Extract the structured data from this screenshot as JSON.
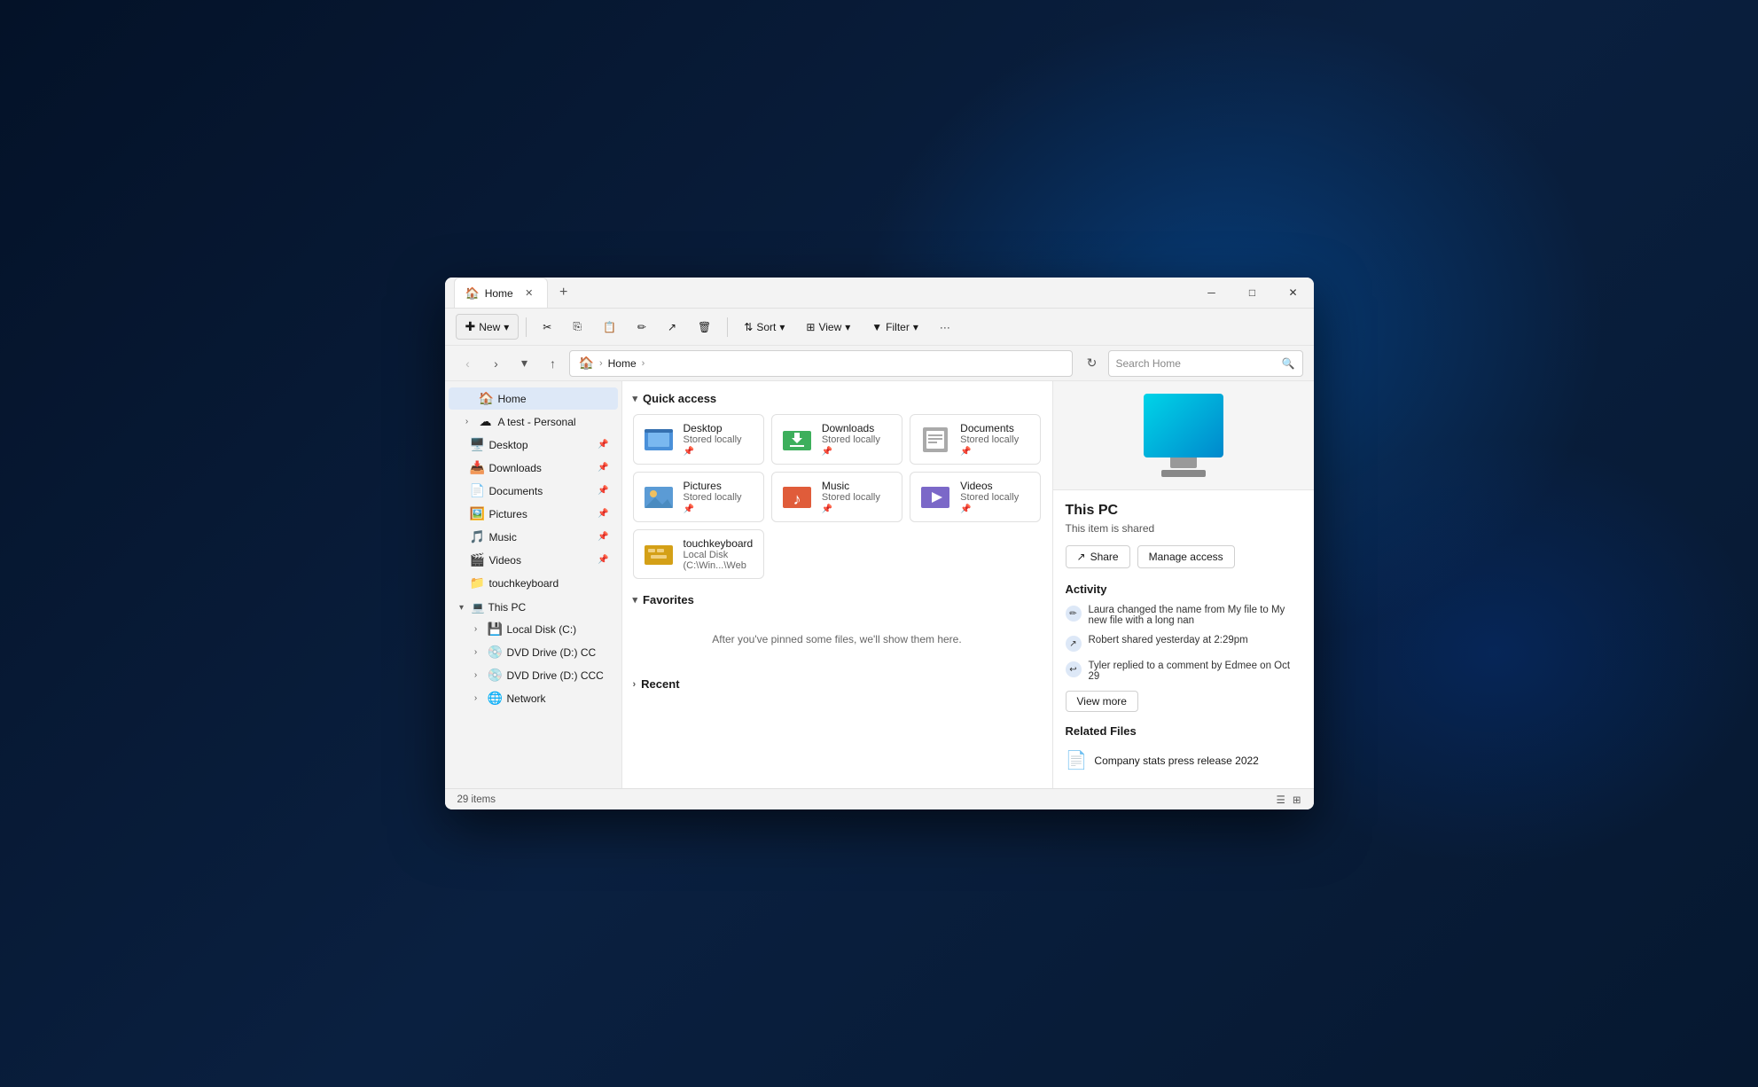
{
  "window": {
    "title": "Home",
    "tab_label": "Home",
    "close": "✕",
    "minimize": "─",
    "maximize": "□"
  },
  "toolbar": {
    "new_label": "New",
    "sort_label": "Sort",
    "view_label": "View",
    "filter_label": "Filter",
    "new_chevron": "▾",
    "sort_chevron": "▾",
    "view_chevron": "▾",
    "filter_chevron": "▾"
  },
  "address_bar": {
    "home_icon": "🏠",
    "home_label": "Home",
    "search_placeholder": "Search Home"
  },
  "sidebar": {
    "home_label": "Home",
    "cloud_label": "A test - Personal",
    "items": [
      {
        "id": "desktop",
        "label": "Desktop",
        "icon": "🖥️",
        "pinned": true
      },
      {
        "id": "downloads",
        "label": "Downloads",
        "icon": "📥",
        "pinned": true
      },
      {
        "id": "documents",
        "label": "Documents",
        "icon": "📄",
        "pinned": true
      },
      {
        "id": "pictures",
        "label": "Pictures",
        "icon": "🖼️",
        "pinned": true
      },
      {
        "id": "music",
        "label": "Music",
        "icon": "🎵",
        "pinned": true
      },
      {
        "id": "videos",
        "label": "Videos",
        "icon": "🎬",
        "pinned": true
      },
      {
        "id": "touchkeyboard",
        "label": "touchkeyboard",
        "icon": "📁",
        "pinned": false
      }
    ],
    "thispc": {
      "label": "This PC",
      "children": [
        {
          "id": "local-disk",
          "label": "Local Disk (C:)",
          "icon": "💾"
        },
        {
          "id": "dvd-d",
          "label": "DVD Drive (D:) CC",
          "icon": "💿"
        },
        {
          "id": "dvd-d2",
          "label": "DVD Drive (D:) CCC",
          "icon": "💿"
        },
        {
          "id": "network",
          "label": "Network",
          "icon": "🌐"
        }
      ]
    }
  },
  "quick_access": {
    "section_label": "Quick access",
    "folders": [
      {
        "id": "desktop",
        "name": "Desktop",
        "sub": "Stored locally",
        "icon": "desktop",
        "pinned": true
      },
      {
        "id": "downloads",
        "name": "Downloads",
        "sub": "Stored locally",
        "icon": "downloads",
        "pinned": true
      },
      {
        "id": "documents",
        "name": "Documents",
        "sub": "Stored locally",
        "icon": "documents",
        "pinned": true
      },
      {
        "id": "pictures",
        "name": "Pictures",
        "sub": "Stored locally",
        "icon": "pictures",
        "pinned": true
      },
      {
        "id": "music",
        "name": "Music",
        "sub": "Stored locally",
        "icon": "music",
        "pinned": true
      },
      {
        "id": "videos",
        "name": "Videos",
        "sub": "Stored locally",
        "icon": "videos",
        "pinned": true
      },
      {
        "id": "touchkb",
        "name": "touchkeyboard",
        "sub": "Local Disk (C:\\Win...\\Web",
        "icon": "touchkb",
        "pinned": false
      }
    ]
  },
  "favorites": {
    "section_label": "Favorites",
    "empty_text": "After you've pinned some files, we'll show them here."
  },
  "recent": {
    "section_label": "Recent"
  },
  "details": {
    "title": "This PC",
    "subtitle": "This item is shared",
    "share_btn": "Share",
    "manage_btn": "Manage access",
    "activity": {
      "section_label": "Activity",
      "items": [
        {
          "text": "Laura changed the name from My file to My new file with a long nan",
          "icon": "✏️"
        },
        {
          "text": "Robert shared yesterday at 2:29pm",
          "icon": "↗"
        },
        {
          "text": "Tyler replied to a comment by Edmee on Oct 29",
          "icon": "↩"
        }
      ],
      "view_more_label": "View more"
    },
    "related_files": {
      "section_label": "Related Files",
      "items": [
        {
          "name": "Company stats press release 2022",
          "icon": "📄"
        }
      ]
    }
  },
  "status_bar": {
    "count_text": "29 items"
  }
}
